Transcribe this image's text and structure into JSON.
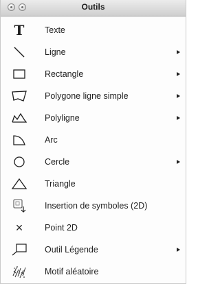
{
  "window": {
    "title": "Outils"
  },
  "menu": {
    "items": [
      {
        "label": "Texte",
        "icon": "text-icon",
        "submenu": false
      },
      {
        "label": "Ligne",
        "icon": "line-icon",
        "submenu": true
      },
      {
        "label": "Rectangle",
        "icon": "rectangle-icon",
        "submenu": true
      },
      {
        "label": "Polygone ligne simple",
        "icon": "polygon-icon",
        "submenu": true
      },
      {
        "label": "Polyligne",
        "icon": "polyline-icon",
        "submenu": true
      },
      {
        "label": "Arc",
        "icon": "arc-icon",
        "submenu": false
      },
      {
        "label": "Cercle",
        "icon": "circle-icon",
        "submenu": true
      },
      {
        "label": "Triangle",
        "icon": "triangle-icon",
        "submenu": false
      },
      {
        "label": "Insertion de symboles (2D)",
        "icon": "symbol-insert-icon",
        "submenu": false
      },
      {
        "label": "Point 2D",
        "icon": "point-2d-icon",
        "submenu": false
      },
      {
        "label": "Outil Légende",
        "icon": "callout-icon",
        "submenu": true
      },
      {
        "label": "Motif aléatoire",
        "icon": "random-pattern-icon",
        "submenu": false
      }
    ]
  }
}
